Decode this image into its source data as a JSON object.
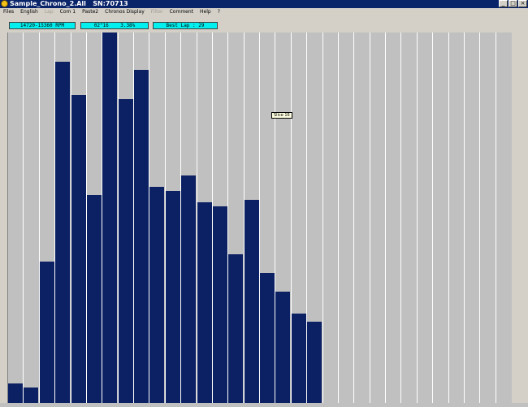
{
  "window": {
    "title": "Sample_Chrono_2.All",
    "serial": "SN:70713",
    "buttons": [
      "_",
      "□",
      "×"
    ]
  },
  "menu": [
    {
      "label": "Files",
      "enabled": true
    },
    {
      "label": "English",
      "enabled": true
    },
    {
      "label": "Lap",
      "enabled": false
    },
    {
      "label": "Com 1",
      "enabled": true
    },
    {
      "label": "Paste2",
      "enabled": true
    },
    {
      "label": "Chronos Display",
      "enabled": true
    },
    {
      "label": "Filter",
      "enabled": false
    },
    {
      "label": "Comment",
      "enabled": true
    },
    {
      "label": "Help",
      "enabled": true
    },
    {
      "label": "?",
      "enabled": true
    }
  ],
  "status": {
    "rpm_range": "14720-15360 RPM",
    "time_pct": "02\"16    3.38%",
    "best_lap": "Best Lap : 29"
  },
  "tooltip": "Slice 16",
  "colors": {
    "bar": "#0c2164",
    "chart_bg": "#c0c0c0",
    "status_bg": "#00f0f0",
    "titlebar": "#0a246a"
  },
  "chart_data": {
    "type": "bar",
    "slices": 32,
    "ylim": [
      0,
      100
    ],
    "values": [
      5.3,
      4.2,
      38.2,
      92.1,
      83.1,
      56.1,
      100,
      82.0,
      89.9,
      58.3,
      57.2,
      61.4,
      54.2,
      53.1,
      40.1,
      54.8,
      35.1,
      30.1,
      24.1,
      22.0,
      0,
      0,
      0,
      0,
      0,
      0,
      0,
      0,
      0,
      0,
      0,
      0
    ]
  }
}
